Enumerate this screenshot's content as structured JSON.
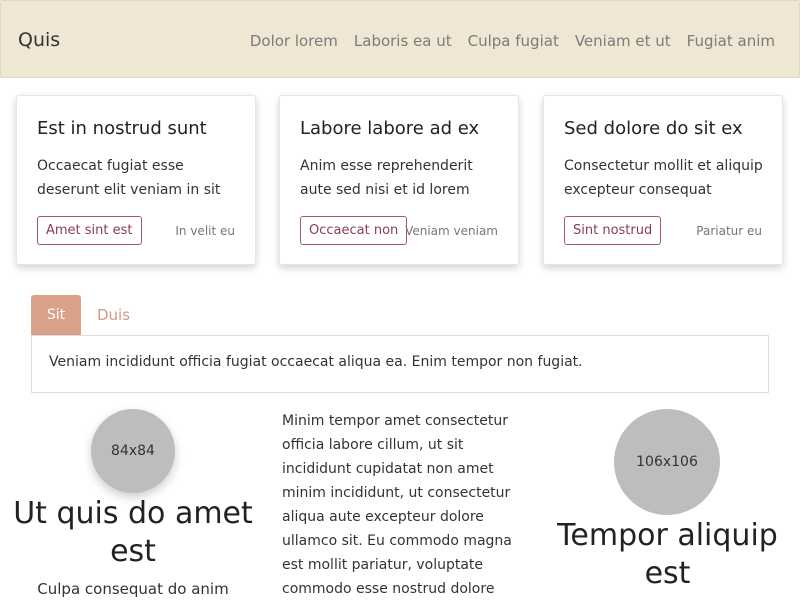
{
  "navbar": {
    "brand": "Quis",
    "links": [
      "Dolor lorem",
      "Laboris ea ut",
      "Culpa fugiat",
      "Veniam et ut",
      "Fugiat anim"
    ]
  },
  "cards": [
    {
      "title": "Est in nostrud sunt",
      "text": "Occaecat fugiat esse deserunt elit veniam in sit",
      "button": "Amet sint est",
      "link": "In velit eu"
    },
    {
      "title": "Labore labore ad ex",
      "text": "Anim esse reprehenderit aute sed nisi et id lorem",
      "button": "Occaecat non",
      "link": "Veniam veniam"
    },
    {
      "title": "Sed dolore do sit ex",
      "text": "Consectetur mollit et aliquip excepteur consequat",
      "button": "Sint nostrud",
      "link": "Pariatur eu"
    }
  ],
  "tabs": {
    "items": [
      "Sit",
      "Duis"
    ],
    "active": "Sit",
    "panel_text": "Veniam incididunt officia fugiat occaecat aliqua ea. Enim tempor non fugiat."
  },
  "lower": {
    "left_avatar": "84x84",
    "left_heading": "Ut quis do amet est",
    "left_subtext": "Culpa consequat do anim",
    "middle_text": "Minim tempor amet consectetur officia labore cillum, ut sit incididunt cupidatat non amet minim incididunt, ut consectetur aliqua aute excepteur dolore ullamco sit. Eu commodo magna est mollit pariatur, voluptate commodo esse nostrud dolore",
    "right_avatar": "106x106",
    "right_heading": "Tempor aliquip est"
  },
  "colors": {
    "navbar_bg": "#efe7d3",
    "tab_active_bg": "#d9a08a",
    "button_border": "#a05a6a",
    "avatar_bg": "#bdbdbd"
  }
}
